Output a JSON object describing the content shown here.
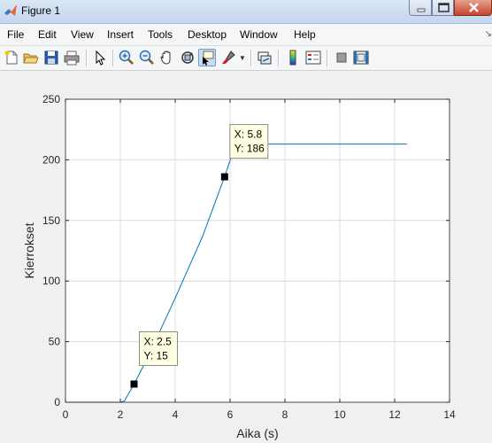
{
  "window": {
    "title": "Figure 1"
  },
  "menu": [
    "File",
    "Edit",
    "View",
    "Insert",
    "Tools",
    "Desktop",
    "Window",
    "Help"
  ],
  "toolbar": {
    "icons": [
      "new-figure-icon",
      "open-file-icon",
      "save-icon",
      "print-icon",
      "edit-plot-arrow-icon",
      "zoom-in-icon",
      "zoom-out-icon",
      "pan-hand-icon",
      "rotate-3d-icon",
      "data-cursor-icon",
      "brush-icon",
      "link-plot-icon",
      "insert-colorbar-icon",
      "insert-legend-icon",
      "hide-plot-tools-icon",
      "show-plot-tools-icon"
    ]
  },
  "chart_data": {
    "type": "line",
    "xlabel": "Aika (s)",
    "ylabel": "Kierrokset",
    "xlim": [
      0,
      14
    ],
    "ylim": [
      0,
      250
    ],
    "xticks": [
      0,
      2,
      4,
      6,
      8,
      10,
      12,
      14
    ],
    "yticks": [
      0,
      50,
      100,
      150,
      200,
      250
    ],
    "grid": true,
    "series": [
      {
        "color": "#0072bd",
        "x": [
          0,
          2.0,
          2.15,
          2.5,
          3.0,
          4.0,
          5.0,
          5.8,
          6.2,
          12.45
        ],
        "y": [
          0,
          0,
          1,
          15,
          37,
          86,
          137,
          186,
          213,
          213
        ]
      }
    ],
    "datatips": [
      {
        "x": 2.5,
        "y": 15,
        "x_text": "X: 2.5",
        "y_text": "Y: 15"
      },
      {
        "x": 5.8,
        "y": 186,
        "x_text": "X: 5.8",
        "y_text": "Y: 186"
      }
    ]
  }
}
